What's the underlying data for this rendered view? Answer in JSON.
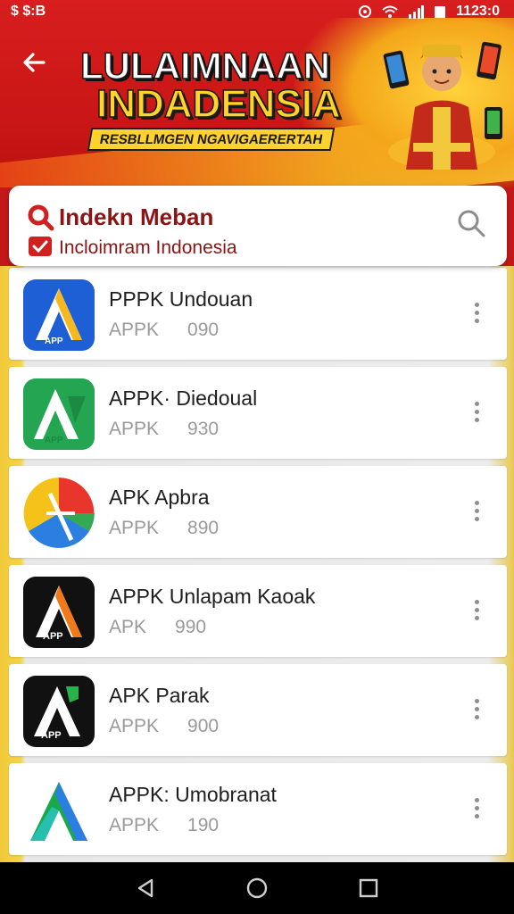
{
  "status_bar": {
    "left_text": "$ $:B",
    "right_text": "1123:0",
    "icons": [
      "notification-icon",
      "wifi-icon",
      "signal-icon",
      "battery-icon"
    ]
  },
  "header": {
    "title_line1": "LULAIMNAAN",
    "title_line2": "INDADENSIA",
    "subtitle": "RESBLLMGEN NGAVIGAERERTAH",
    "back_icon": "back-arrow-icon"
  },
  "search": {
    "title": "Indekn Meban",
    "subtitle": "Incloimram Indonesia",
    "icon": "search-icon"
  },
  "apps": [
    {
      "name": "PPPK  Undouan",
      "label": "APPK",
      "count": "090",
      "icon_color": "#1f5fd6",
      "accent": "#f5b820",
      "bg": "#1f5fd6"
    },
    {
      "name": "APPK· Diedoual",
      "label": "APPK",
      "count": "930",
      "icon_color": "#23a552",
      "accent": "#ffffff",
      "bg": "#23a552"
    },
    {
      "name": "APK  Apbra",
      "label": "APPK",
      "count": "890",
      "icon_color": "#ffffff",
      "accent": "#e8362c",
      "bg": "#ffffff"
    },
    {
      "name": "APPK Unlapam  Kaoak",
      "label": "APK",
      "count": "990",
      "icon_color": "#111111",
      "accent": "#f07a1a",
      "bg": "#111111"
    },
    {
      "name": "APK  Parak",
      "label": "APPK",
      "count": "900",
      "icon_color": "#111111",
      "accent": "#27b24a",
      "bg": "#111111"
    },
    {
      "name": "APPK: Umobranat",
      "label": "APPK",
      "count": "190",
      "icon_color": "#ffffff",
      "accent": "#1aa84a",
      "bg": "#ffffff"
    }
  ],
  "nav": {
    "back": "nav-back-icon",
    "home": "nav-home-icon",
    "recents": "nav-recents-icon"
  },
  "colors": {
    "header_red": "#c81515",
    "accent_gold": "#ffd22e",
    "search_text": "#8b1414"
  }
}
